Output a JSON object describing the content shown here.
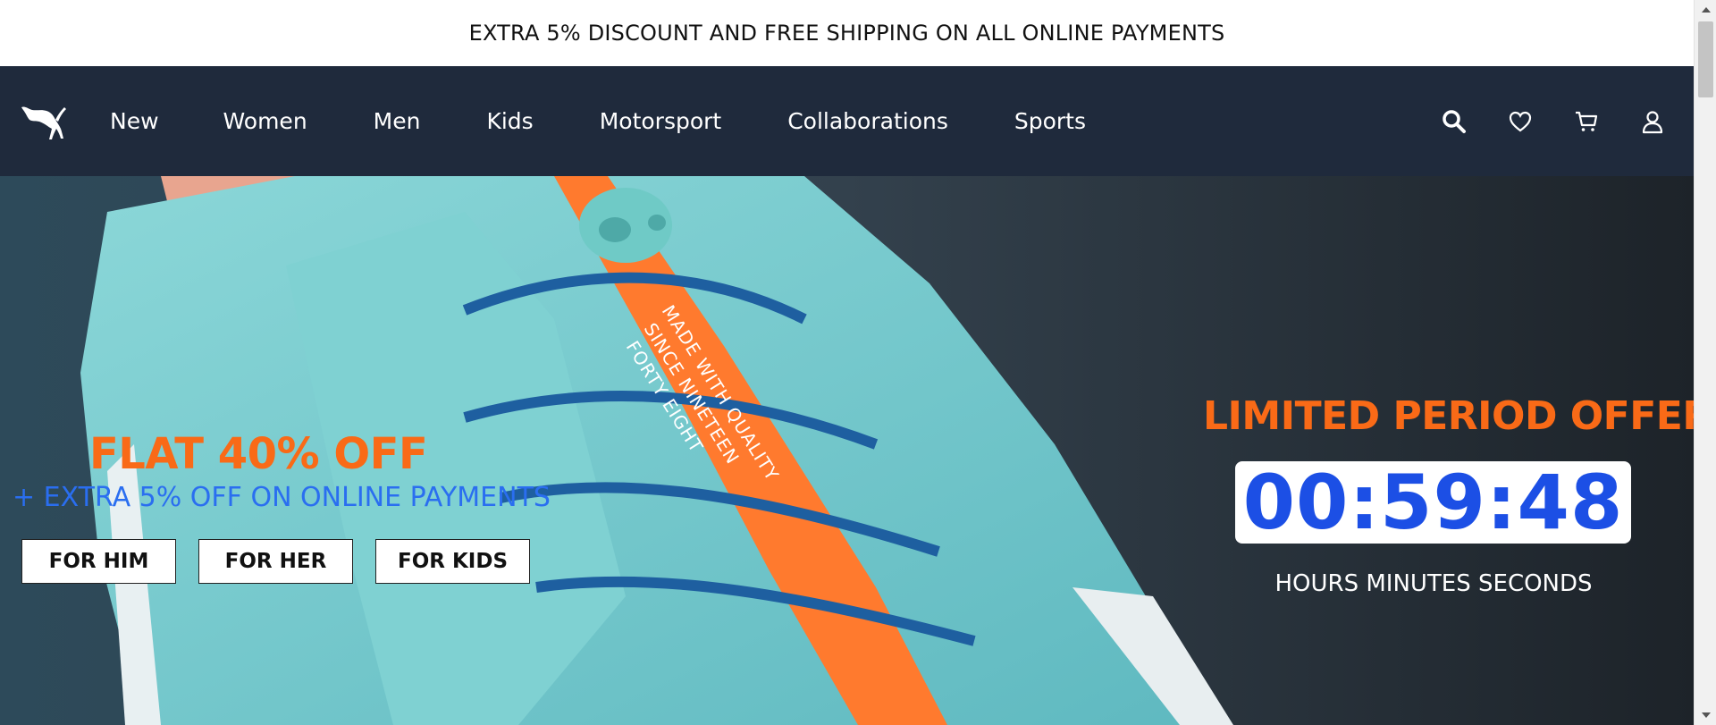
{
  "announcement": {
    "text": "EXTRA 5% DISCOUNT AND FREE SHIPPING ON ALL ONLINE PAYMENTS"
  },
  "nav": {
    "logo_icon": "puma-logo-icon",
    "links": [
      "New",
      "Women",
      "Men",
      "Kids",
      "Motorsport",
      "Collaborations",
      "Sports"
    ],
    "icons": [
      "search-icon",
      "heart-icon",
      "cart-icon",
      "user-icon"
    ]
  },
  "hero": {
    "background_description_colors": {
      "shoe_teal": "#7dd0d3",
      "strap_orange": "#ff7a2e",
      "lace_blue": "#1e5fa0"
    },
    "strap_text": [
      "MADE WITH QUALITY",
      "SINCE NINETEEN",
      "FORTY EIGHT"
    ],
    "promo_title": "FLAT 40% OFF",
    "promo_subtitle": "+ EXTRA 5% OFF ON ONLINE PAYMENTS",
    "cta_buttons": [
      "FOR HIM",
      "FOR HER",
      "FOR KIDS"
    ],
    "offer_title": "LIMITED PERIOD OFFER",
    "timer": "00:59:48",
    "timer_labels": "HOURS MINUTES SECONDS"
  },
  "colors": {
    "nav_bg": "#1f2a3c",
    "accent_orange": "#f96a17",
    "accent_blue": "#1c4fe5",
    "subtitle_blue": "#2a6ef0"
  }
}
